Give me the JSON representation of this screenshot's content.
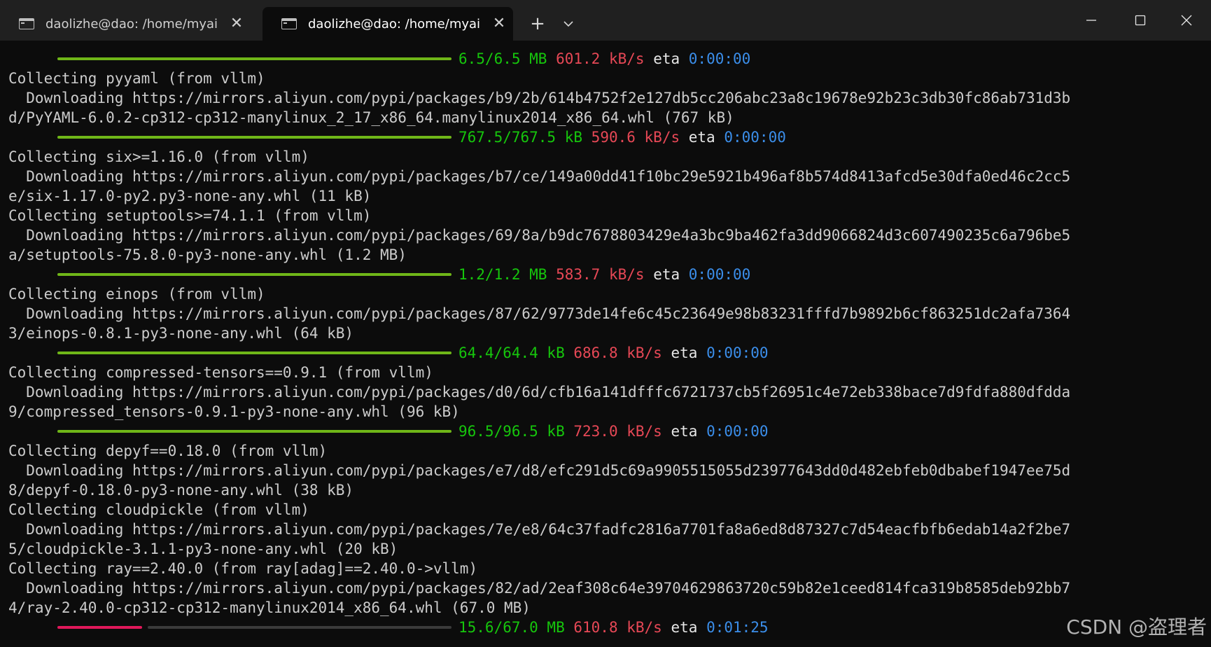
{
  "tabs": [
    {
      "title": "daolizhe@dao: /home/myai/m",
      "active": false
    },
    {
      "title": "daolizhe@dao: /home/myai/r",
      "active": true
    }
  ],
  "tabbar": {
    "close_glyph": "✕",
    "new_tab_glyph": "+",
    "dropdown_glyph": "⌄"
  },
  "colors": {
    "background": "#0c0c0c",
    "tabbar": "#202020",
    "progress_complete": "#6fb618",
    "progress_active": "#e0185a",
    "progress_remaining": "#3a3a3a",
    "size_text": "#16c60c",
    "speed_text": "#e74856",
    "eta_text": "#3b8eea"
  },
  "terminal": {
    "lines": [
      {
        "kind": "progress",
        "state": "complete",
        "progress": 1.0,
        "size": "6.5/6.5 MB",
        "speed": "601.2 kB/s",
        "eta_label": "eta",
        "eta": "0:00:00"
      },
      {
        "kind": "text",
        "text": "Collecting pyyaml (from vllm)"
      },
      {
        "kind": "text",
        "text": "  Downloading https://mirrors.aliyun.com/pypi/packages/b9/2b/614b4752f2e127db5cc206abc23a8c19678e92b23c3db30fc86ab731d3b"
      },
      {
        "kind": "text",
        "text": "d/PyYAML-6.0.2-cp312-cp312-manylinux_2_17_x86_64.manylinux2014_x86_64.whl (767 kB)"
      },
      {
        "kind": "progress",
        "state": "complete",
        "progress": 1.0,
        "size": "767.5/767.5 kB",
        "speed": "590.6 kB/s",
        "eta_label": "eta",
        "eta": "0:00:00"
      },
      {
        "kind": "text",
        "text": "Collecting six>=1.16.0 (from vllm)"
      },
      {
        "kind": "text",
        "text": "  Downloading https://mirrors.aliyun.com/pypi/packages/b7/ce/149a00dd41f10bc29e5921b496af8b574d8413afcd5e30dfa0ed46c2cc5"
      },
      {
        "kind": "text",
        "text": "e/six-1.17.0-py2.py3-none-any.whl (11 kB)"
      },
      {
        "kind": "text",
        "text": "Collecting setuptools>=74.1.1 (from vllm)"
      },
      {
        "kind": "text",
        "text": "  Downloading https://mirrors.aliyun.com/pypi/packages/69/8a/b9dc7678803429e4a3bc9ba462fa3dd9066824d3c607490235c6a796be5"
      },
      {
        "kind": "text",
        "text": "a/setuptools-75.8.0-py3-none-any.whl (1.2 MB)"
      },
      {
        "kind": "progress",
        "state": "complete",
        "progress": 1.0,
        "size": "1.2/1.2 MB",
        "speed": "583.7 kB/s",
        "eta_label": "eta",
        "eta": "0:00:00"
      },
      {
        "kind": "text",
        "text": "Collecting einops (from vllm)"
      },
      {
        "kind": "text",
        "text": "  Downloading https://mirrors.aliyun.com/pypi/packages/87/62/9773de14fe6c45c23649e98b83231fffd7b9892b6cf863251dc2afa7364"
      },
      {
        "kind": "text",
        "text": "3/einops-0.8.1-py3-none-any.whl (64 kB)"
      },
      {
        "kind": "progress",
        "state": "complete",
        "progress": 1.0,
        "size": "64.4/64.4 kB",
        "speed": "686.8 kB/s",
        "eta_label": "eta",
        "eta": "0:00:00"
      },
      {
        "kind": "text",
        "text": "Collecting compressed-tensors==0.9.1 (from vllm)"
      },
      {
        "kind": "text",
        "text": "  Downloading https://mirrors.aliyun.com/pypi/packages/d0/6d/cfb16a141dfffc6721737cb5f26951c4e72eb338bace7d9fdfa880dfdda"
      },
      {
        "kind": "text",
        "text": "9/compressed_tensors-0.9.1-py3-none-any.whl (96 kB)"
      },
      {
        "kind": "progress",
        "state": "complete",
        "progress": 1.0,
        "size": "96.5/96.5 kB",
        "speed": "723.0 kB/s",
        "eta_label": "eta",
        "eta": "0:00:00"
      },
      {
        "kind": "text",
        "text": "Collecting depyf==0.18.0 (from vllm)"
      },
      {
        "kind": "text",
        "text": "  Downloading https://mirrors.aliyun.com/pypi/packages/e7/d8/efc291d5c69a9905515055d23977643dd0d482ebfeb0dbabef1947ee75d"
      },
      {
        "kind": "text",
        "text": "8/depyf-0.18.0-py3-none-any.whl (38 kB)"
      },
      {
        "kind": "text",
        "text": "Collecting cloudpickle (from vllm)"
      },
      {
        "kind": "text",
        "text": "  Downloading https://mirrors.aliyun.com/pypi/packages/7e/e8/64c37fadfc2816a7701fa8a6ed8d87327c7d54eacfbfb6edab14a2f2be7"
      },
      {
        "kind": "text",
        "text": "5/cloudpickle-3.1.1-py3-none-any.whl (20 kB)"
      },
      {
        "kind": "text",
        "text": "Collecting ray==2.40.0 (from ray[adag]==2.40.0->vllm)"
      },
      {
        "kind": "text",
        "text": "  Downloading https://mirrors.aliyun.com/pypi/packages/82/ad/2eaf308c64e39704629863720c59b82e1ceed814fca319b8585deb92bb7"
      },
      {
        "kind": "text",
        "text": "4/ray-2.40.0-cp312-cp312-manylinux2014_x86_64.whl (67.0 MB)"
      },
      {
        "kind": "progress",
        "state": "active",
        "progress": 0.233,
        "size": "15.6/67.0 MB",
        "speed": "610.8 kB/s",
        "eta_label": "eta",
        "eta": "0:01:25"
      }
    ]
  },
  "watermark": "CSDN @盗理者"
}
